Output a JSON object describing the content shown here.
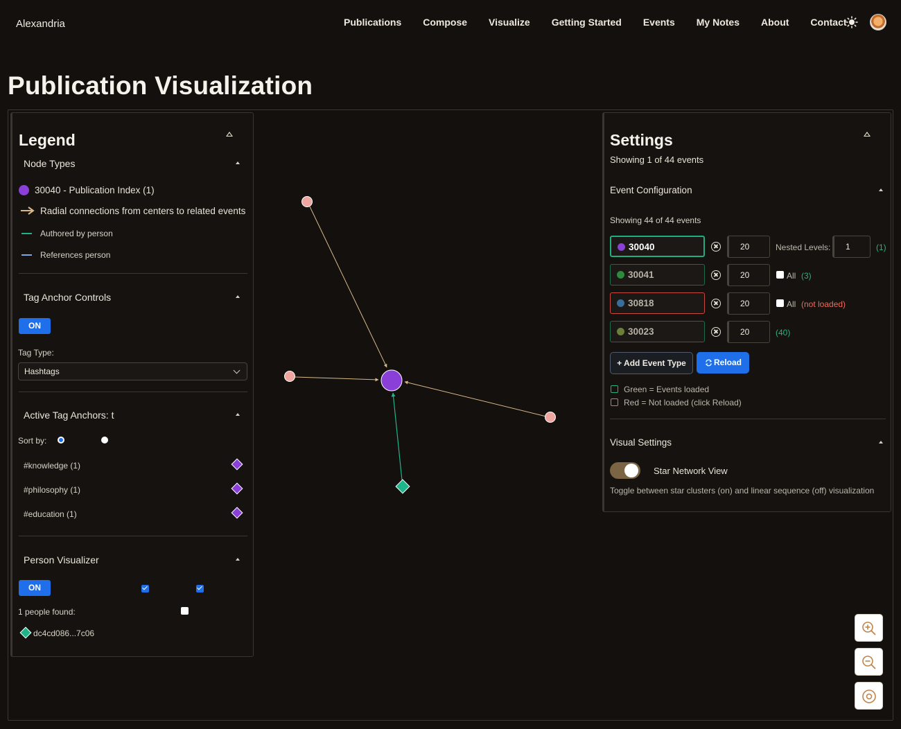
{
  "brand": "Alexandria",
  "nav": [
    "Publications",
    "Compose",
    "Visualize",
    "Getting Started",
    "Events",
    "My Notes",
    "About",
    "Contact"
  ],
  "page_title": "Publication Visualization",
  "legend": {
    "title": "Legend",
    "node_types": {
      "title": "Node Types",
      "items": [
        {
          "label": "30040 - Publication Index (1)",
          "color": "#8a3fd9"
        },
        {
          "label": "Radial connections from centers to related events"
        },
        {
          "label": "Authored by person",
          "color": "#1fb58a"
        },
        {
          "label": "References person",
          "color": "#7fa7e8"
        }
      ]
    },
    "tag_anchor": {
      "title": "Tag Anchor Controls",
      "toggle": "ON",
      "tag_type_label": "Tag Type:",
      "tag_type_value": "Hashtags"
    },
    "active_tags": {
      "title": "Active Tag Anchors: t",
      "sort_label": "Sort by:",
      "items": [
        "#knowledge (1)",
        "#philosophy (1)",
        "#education (1)"
      ]
    },
    "person": {
      "title": "Person Visualizer",
      "toggle": "ON",
      "found_label": "1 people found:",
      "person_id": "dc4cd086...7c06"
    }
  },
  "settings": {
    "title": "Settings",
    "subtitle": "Showing 1 of 44 events",
    "event_config": {
      "title": "Event Configuration",
      "showing": "Showing 44 of 44 events",
      "rows": [
        {
          "kind": "30040",
          "limit": "20",
          "extra_label": "Nested Levels:",
          "extra_value": "1",
          "status": "(1)",
          "dot": "#8a3fd9",
          "border": "#1fae80"
        },
        {
          "kind": "30041",
          "limit": "20",
          "extra_label": "All",
          "status": "(3)",
          "dot": "#2e8a3c",
          "border": "#1d6b4d"
        },
        {
          "kind": "30818",
          "limit": "20",
          "extra_label": "All",
          "status": "(not loaded)",
          "dot": "#3a6d9a",
          "border": "#c74a42"
        },
        {
          "kind": "30023",
          "limit": "20",
          "status": "(40)",
          "dot": "#6b7e3a",
          "border": "#1d6b4d"
        }
      ],
      "add_button": "+ Add Event Type",
      "reload_button": "Reload",
      "legend_green": "Green = Events loaded",
      "legend_red": "Red = Not loaded (click Reload)"
    },
    "visual": {
      "title": "Visual Settings",
      "toggle_label": "Star Network View",
      "toggle_on": true,
      "description": "Toggle between star clusters (on) and linear sequence (off) visualization"
    }
  },
  "zoom": {
    "in_icon": "zoom-in-icon",
    "out_icon": "zoom-out-icon",
    "center_icon": "target-icon"
  }
}
